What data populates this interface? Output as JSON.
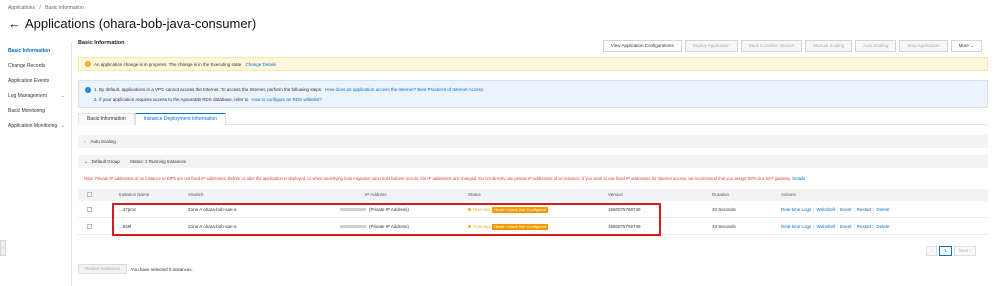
{
  "breadcrumb": {
    "root": "Applications",
    "sep": "/",
    "current": "Basic Information"
  },
  "page": {
    "title": "Applications (ohara-bob-java-consumer)",
    "back_icon": "←"
  },
  "sidebar": {
    "items": [
      {
        "label": "Basic Information",
        "active": true,
        "chevron": ""
      },
      {
        "label": "Change Records",
        "chevron": ""
      },
      {
        "label": "Application Events",
        "chevron": ""
      },
      {
        "label": "Log Management",
        "chevron": "⌄"
      },
      {
        "label": "Basic Monitoring",
        "chevron": ""
      },
      {
        "label": "Application Monitoring",
        "chevron": "⌄"
      }
    ],
    "collapse_icon": "‹"
  },
  "section": {
    "title": "Basic Information"
  },
  "toolbar": {
    "view_config": "View Application Configurations",
    "deploy": "Deploy Application",
    "back_version": "Back to Earlier Version",
    "manual_scaling": "Manual Scaling",
    "auto_scaling": "Auto Scaling",
    "stop": "Stop Application",
    "more": "More",
    "more_icon": "⌄"
  },
  "warning": {
    "text": "An application change is in progress. The change is in the Executing state.",
    "link": "Change Details",
    "icon": "!"
  },
  "info": {
    "icon": "i",
    "line1_text": "1. By default, applications in a VPC cannot access the Internet. To access the Internet, perform the following steps:",
    "line1_link": "How does an application access the Internet? Best Practices of Internet Access",
    "line2_text": "2. If your application requires access to the ApsaraDB RDS database, refer to",
    "line2_link": "How to configure an RDS whitelist?"
  },
  "tabs": [
    {
      "label": "Basic Information",
      "active": false
    },
    {
      "label": "Instance Deployment Information",
      "active": true
    }
  ],
  "auto_scaling": {
    "label": "Auto Scaling",
    "icon": "›"
  },
  "group": {
    "icon": "⌄",
    "label": "Default Group",
    "status": "Status: 2 Running Instances"
  },
  "note": {
    "text": "Note: Private IP addresses of an instance or EIPs are not fixed IP addresses. Before or after the application is deployed, or when underlying host migration upon host failover occurs, the IP addresses are changed. Do not directly use private IP addresses of an instance. If you want to use fixed IP addresses for Internet access, we recommend that you assign EIPs to a NAT gateway.",
    "link": "Details"
  },
  "table": {
    "columns": [
      "Instance Name",
      "vSwitch",
      "IP Address",
      "Status",
      "Version",
      "Duration",
      "Actions"
    ],
    "rows": [
      {
        "name": "...47pmc",
        "vswitch": "Zone A ohara-bob-sae-a",
        "ip_suffix": "(Private IP Address)",
        "status": "Running",
        "health": "Health Check Not Configured",
        "version": "1660075769749",
        "duration": "33 Seconds"
      },
      {
        "name": "...5s9f",
        "vswitch": "Zone A ohara-bob-sae-a",
        "ip_suffix": "(Private IP Address)",
        "status": "Running",
        "health": "Health Check Not Configured",
        "version": "1660075769749",
        "duration": "33 Seconds"
      }
    ],
    "actions": {
      "logs": "Real-time Logs",
      "webshell": "Webshell",
      "event": "Event",
      "restart": "Restart",
      "delete": "Delete",
      "sep": "|"
    }
  },
  "pagination": {
    "prev": "‹",
    "current": "1",
    "next": "Next ›"
  },
  "bottom": {
    "restart_button": "Restart Instances",
    "selected_text": "You have selected 0 instances."
  },
  "colors": {
    "accent": "#0070cc",
    "warning": "#f5a623",
    "badge": "#f39800",
    "note": "#e4393c",
    "highlight": "#d71920"
  }
}
